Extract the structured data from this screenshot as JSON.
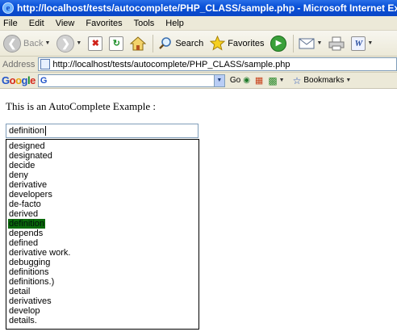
{
  "window": {
    "title": "http://localhost/tests/autocomplete/PHP_CLASS/sample.php - Microsoft Internet Explorer"
  },
  "menu": [
    "File",
    "Edit",
    "View",
    "Favorites",
    "Tools",
    "Help"
  ],
  "toolbar": {
    "back_label": "Back",
    "search_label": "Search",
    "favorites_label": "Favorites"
  },
  "address": {
    "label": "Address",
    "url": "http://localhost/tests/autocomplete/PHP_CLASS/sample.php"
  },
  "googlebar": {
    "logo": "Google",
    "search_icon": "G",
    "go_label": "Go",
    "bookmarks_label": "Bookmarks"
  },
  "page": {
    "intro_text": "This is an AutoComplete Example :",
    "input_value": "definition",
    "suggestions": [
      "designed",
      "designated",
      "decide",
      "deny",
      "derivative",
      "developers",
      "de-facto",
      "derived",
      "definition",
      "depends",
      "defined",
      "derivative work.",
      "debugging",
      "definitions",
      "definitions.)",
      "detail",
      "derivatives",
      "develop",
      "details."
    ],
    "selected_index": 8
  },
  "colors": {
    "titlebar": "#0a52d8",
    "chrome": "#ece9d8",
    "selection": "#0b6a0b"
  }
}
